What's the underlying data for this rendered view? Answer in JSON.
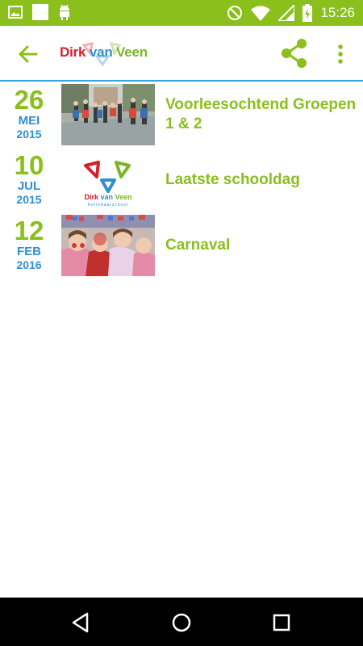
{
  "status_bar": {
    "time": "15:26",
    "icons": [
      "image-notification-icon",
      "square-notification-icon",
      "android-notification-icon",
      "do-not-disturb-icon",
      "wifi-icon",
      "signal-icon",
      "battery-charging-icon"
    ]
  },
  "toolbar": {
    "logo_parts": [
      "Dirk",
      "van",
      "Veen"
    ],
    "icons": [
      "back-arrow-icon",
      "share-icon",
      "more-vert-icon"
    ]
  },
  "items": [
    {
      "day": "26",
      "month": "MEI",
      "year": "2015",
      "title": "Voorleesochtend Groepen 1 & 2",
      "thumb": "photo-children-outside"
    },
    {
      "day": "10",
      "month": "JUL",
      "year": "2015",
      "title": "Laatste schooldag",
      "thumb": "school-logo"
    },
    {
      "day": "12",
      "month": "FEB",
      "year": "2016",
      "title": "Carnaval",
      "thumb": "photo-carnaval-children"
    }
  ],
  "thumb_logo": {
    "line1_parts": [
      "Dirk",
      "van",
      "Veen"
    ],
    "line2": "Kellebaatschool"
  },
  "colors": {
    "accent_green": "#8bbf1c",
    "accent_blue": "#2f8fd2",
    "brand_red": "#d5202a",
    "status_bar": "#8bbf1c",
    "divider": "#37a4dc"
  },
  "navigation_bar": {
    "icons": [
      "back-triangle-icon",
      "home-circle-icon",
      "recents-square-icon"
    ]
  }
}
